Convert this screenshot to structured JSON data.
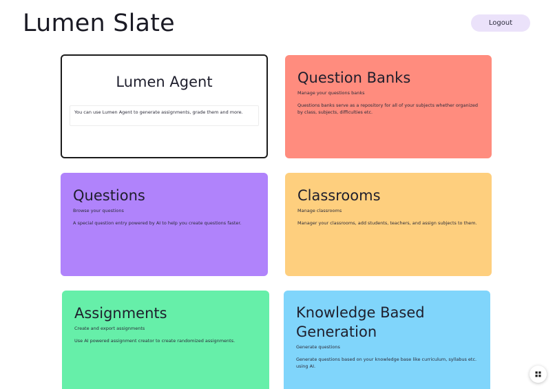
{
  "header": {
    "title": "Lumen Slate",
    "logout_label": "Logout"
  },
  "cards": {
    "agent": {
      "title": "Lumen Agent",
      "description": "You can use Lumen Agent to generate assignments, grade them and more."
    },
    "question_banks": {
      "title": "Question Banks",
      "subtitle": "Manage your questions banks",
      "description": "Questions banks serve as a repository for all of your subjects whether organized by class, subjects, difficulties etc."
    },
    "questions": {
      "title": "Questions",
      "subtitle": "Browse your questions",
      "description": "A special question entry powered by AI to help you create questions faster."
    },
    "classrooms": {
      "title": "Classrooms",
      "subtitle": "Manage classrooms",
      "description": "Manager your classrooms, add students, teachers, and assign subjects to them."
    },
    "assignments": {
      "title": "Assignments",
      "subtitle": "Create and export assignments",
      "description": "Use AI powered assignment creator to create randomized assignments."
    },
    "knowledge_generation": {
      "title": "Knowledge Based Generation",
      "subtitle": "Generate questions",
      "description": "Generate questions based on your knowledge base like curriculum, syllabus etc. using AI."
    }
  },
  "icons": {
    "fab": "grid-icon"
  },
  "colors": {
    "question_banks": "#ff8c7e",
    "questions": "#b083fb",
    "classrooms": "#fecf7e",
    "assignments": "#66efa9",
    "knowledge_generation": "#80d5fb",
    "logout_bg": "#ebe2fa"
  }
}
